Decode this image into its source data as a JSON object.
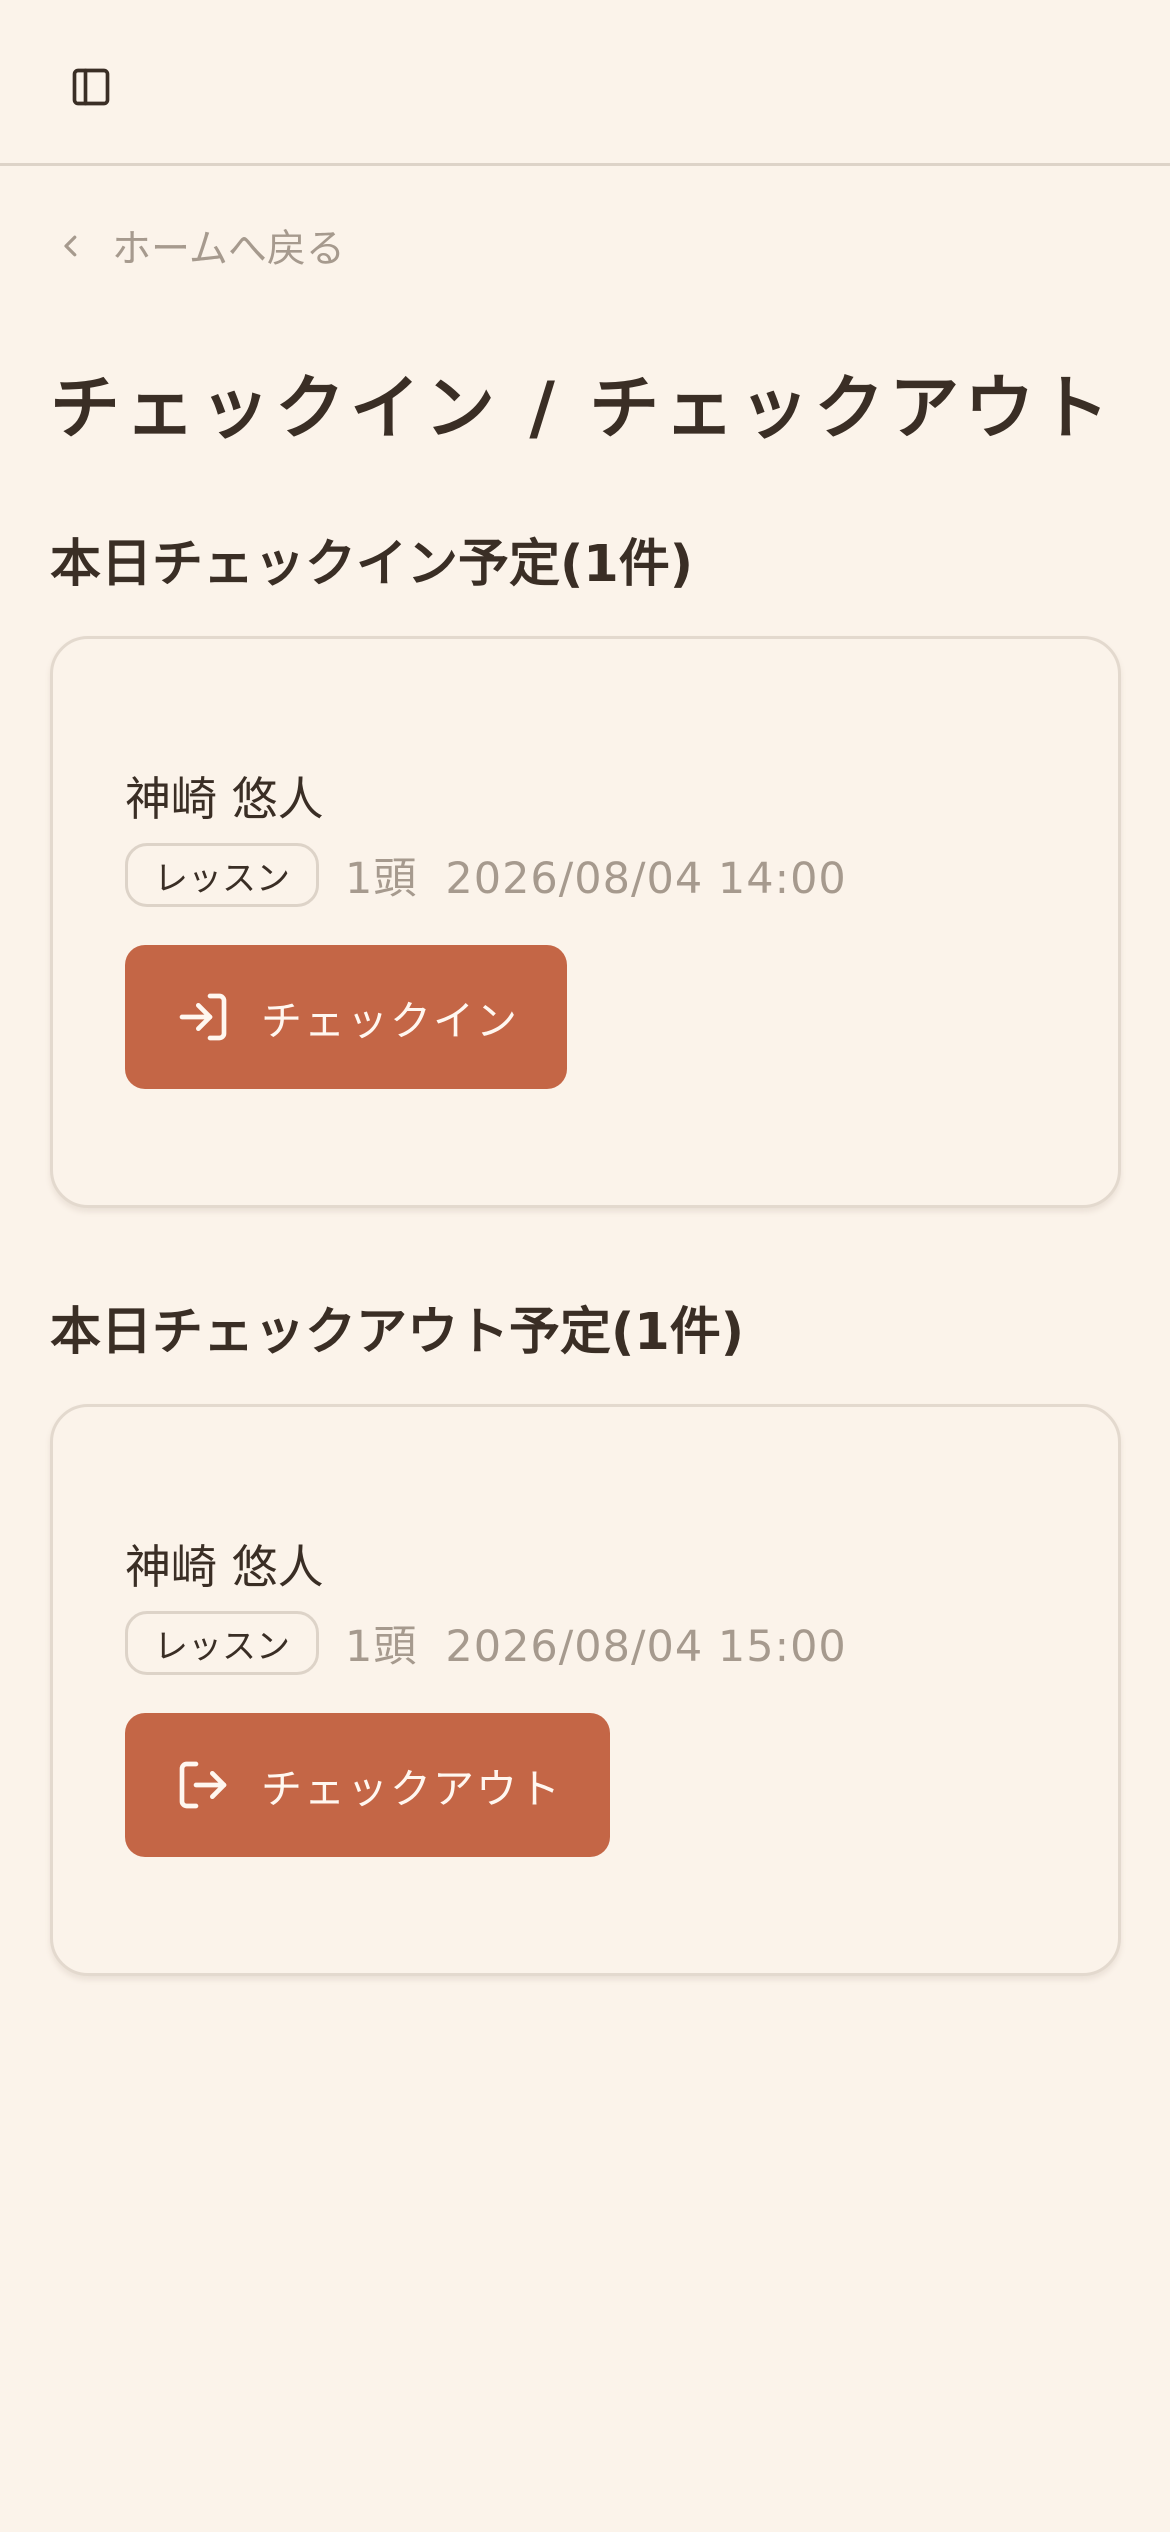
{
  "header": {
    "toggle_icon": "sidebar-panel-icon"
  },
  "nav": {
    "back_label": "ホームへ戻る"
  },
  "page": {
    "title": "チェックイン / チェックアウト"
  },
  "checkin_section": {
    "title": "本日チェックイン予定(1件)",
    "items": [
      {
        "name": "神崎 悠人",
        "badge": "レッスン",
        "count": "1頭",
        "datetime": "2026/08/04 14:00",
        "button_label": "チェックイン",
        "button_icon": "log-in-icon"
      }
    ]
  },
  "checkout_section": {
    "title": "本日チェックアウト予定(1件)",
    "items": [
      {
        "name": "神崎 悠人",
        "badge": "レッスン",
        "count": "1頭",
        "datetime": "2026/08/04 15:00",
        "button_label": "チェックアウト",
        "button_icon": "log-out-icon"
      }
    ]
  },
  "colors": {
    "background": "#FBF3EA",
    "accent": "#C46646",
    "text": "#3A2E25",
    "muted": "#A69A8E",
    "border": "#DDD3C8"
  }
}
